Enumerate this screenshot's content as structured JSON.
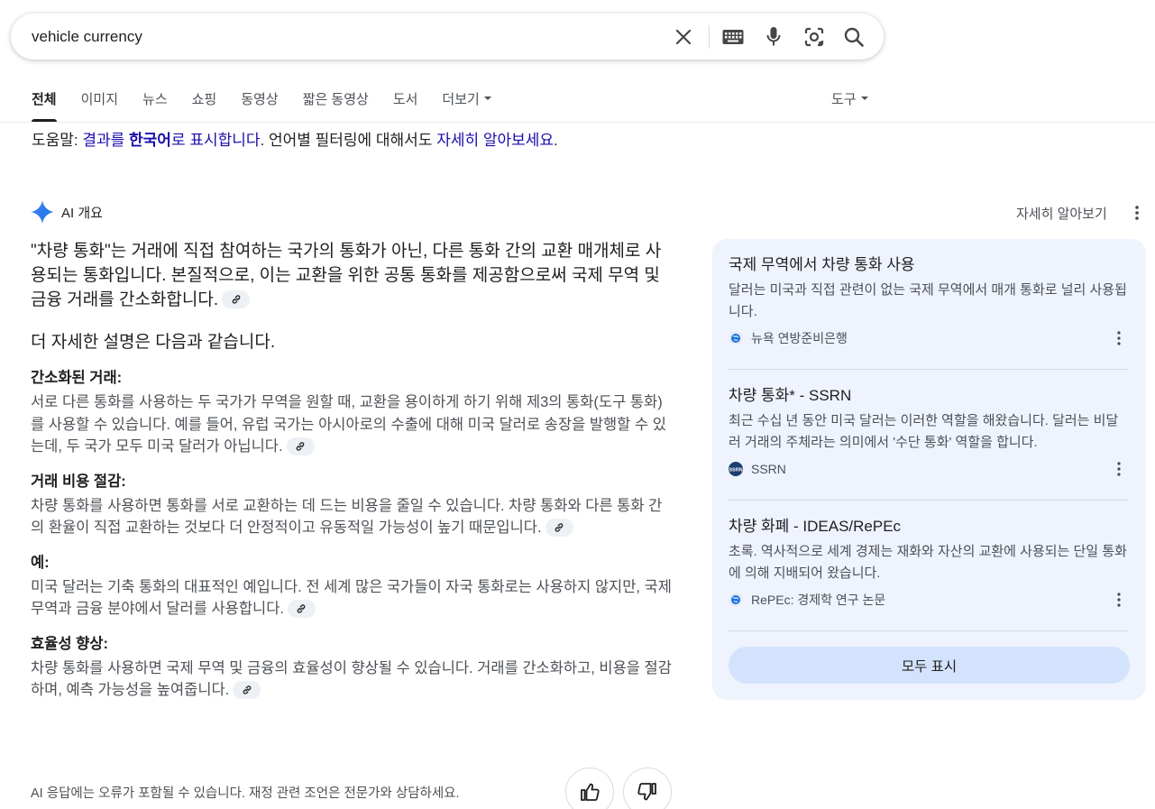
{
  "search": {
    "query": "vehicle currency"
  },
  "icons": {
    "clear": "close-icon",
    "keyboard": "keyboard-icon",
    "voice": "mic-icon",
    "lens": "camera-lens-icon",
    "search": "search-icon"
  },
  "tabs": [
    {
      "label": "전체",
      "active": true
    },
    {
      "label": "이미지"
    },
    {
      "label": "뉴스"
    },
    {
      "label": "쇼핑"
    },
    {
      "label": "동영상"
    },
    {
      "label": "짧은 동영상"
    },
    {
      "label": "도서"
    },
    {
      "label": "더보기"
    }
  ],
  "tools_label": "도구",
  "help": {
    "prefix": "도움말: ",
    "link1_pre": "결과를 ",
    "link1_bold": "한국어",
    "link1_post": "로 표시합니다",
    "middle": ". 언어별 필터링에 대해서도 ",
    "link2": "자세히 알아보세요",
    "suffix": "."
  },
  "ai_overview": {
    "label": "AI 개요",
    "learn_more": "자세히 알아보기",
    "intro": "\"차량 통화\"는 거래에 직접 참여하는 국가의 통화가 아닌, 다른 통화 간의 교환 매개체로 사용되는 통화입니다. 본질적으로, 이는 교환을 위한 공통 통화를 제공함으로써 국제 무역 및 금융 거래를 간소화합니다.",
    "sub_intro": "더 자세한 설명은 다음과 같습니다.",
    "points": [
      {
        "title": "간소화된 거래:",
        "body": "서로 다른 통화를 사용하는 두 국가가 무역을 원할 때, 교환을 용이하게 하기 위해 제3의 통화(도구 통화)를 사용할 수 있습니다. 예를 들어, 유럽 국가는 아시아로의 수출에 대해 미국 달러로 송장을 발행할 수 있는데, 두 국가 모두 미국 달러가 아닙니다."
      },
      {
        "title": "거래 비용 절감:",
        "body": "차량 통화를 사용하면 통화를 서로 교환하는 데 드는 비용을 줄일 수 있습니다. 차량 통화와 다른 통화 간의 환율이 직접 교환하는 것보다 더 안정적이고 유동적일 가능성이 높기 때문입니다."
      },
      {
        "title": "예:",
        "body": "미국 달러는 기축 통화의 대표적인 예입니다. 전 세계 많은 국가들이 자국 통화로는 사용하지 않지만, 국제 무역과 금융 분야에서 달러를 사용합니다."
      },
      {
        "title": "효율성 향상:",
        "body": "차량 통화를 사용하면 국제 무역 및 금융의 효율성이 향상될 수 있습니다. 거래를 간소화하고, 비용을 절감하며, 예측 가능성을 높여줍니다."
      }
    ],
    "disclaimer": "AI 응답에는 오류가 포함될 수 있습니다. 재정 관련 조언은 전문가와 상담하세요."
  },
  "sources": [
    {
      "title": "국제 무역에서 차량 통화 사용",
      "snippet": "달러는 미국과 직접 관련이 없는 국제 무역에서 매개 통화로 널리 사용됩니다.",
      "site": "뉴욕 연방준비은행",
      "icon": "globe-icon"
    },
    {
      "title": "차량 통화* - SSRN",
      "snippet": "최근 수십 년 동안 미국 달러는 이러한 역할을 해왔습니다. 달러는 비달러 거래의 주체라는 의미에서 '수단 통화' 역할을 합니다.",
      "site": "SSRN",
      "icon": "ssrn-logo-icon"
    },
    {
      "title": "차량 화폐 - IDEAS/RePEc",
      "snippet": "초록. 역사적으로 세계 경제는 재화와 자산의 교환에 사용되는 단일 통화에 의해 지배되어 왔습니다.",
      "site": "RePEc: 경제학 연구 논문",
      "icon": "globe-icon"
    }
  ],
  "show_all": "모두 표시",
  "colors": {
    "link": "#1a0dab",
    "ai_accent": "#4285f4",
    "panel_bg": "#eef3fd",
    "button_bg": "#d3e3fd"
  }
}
